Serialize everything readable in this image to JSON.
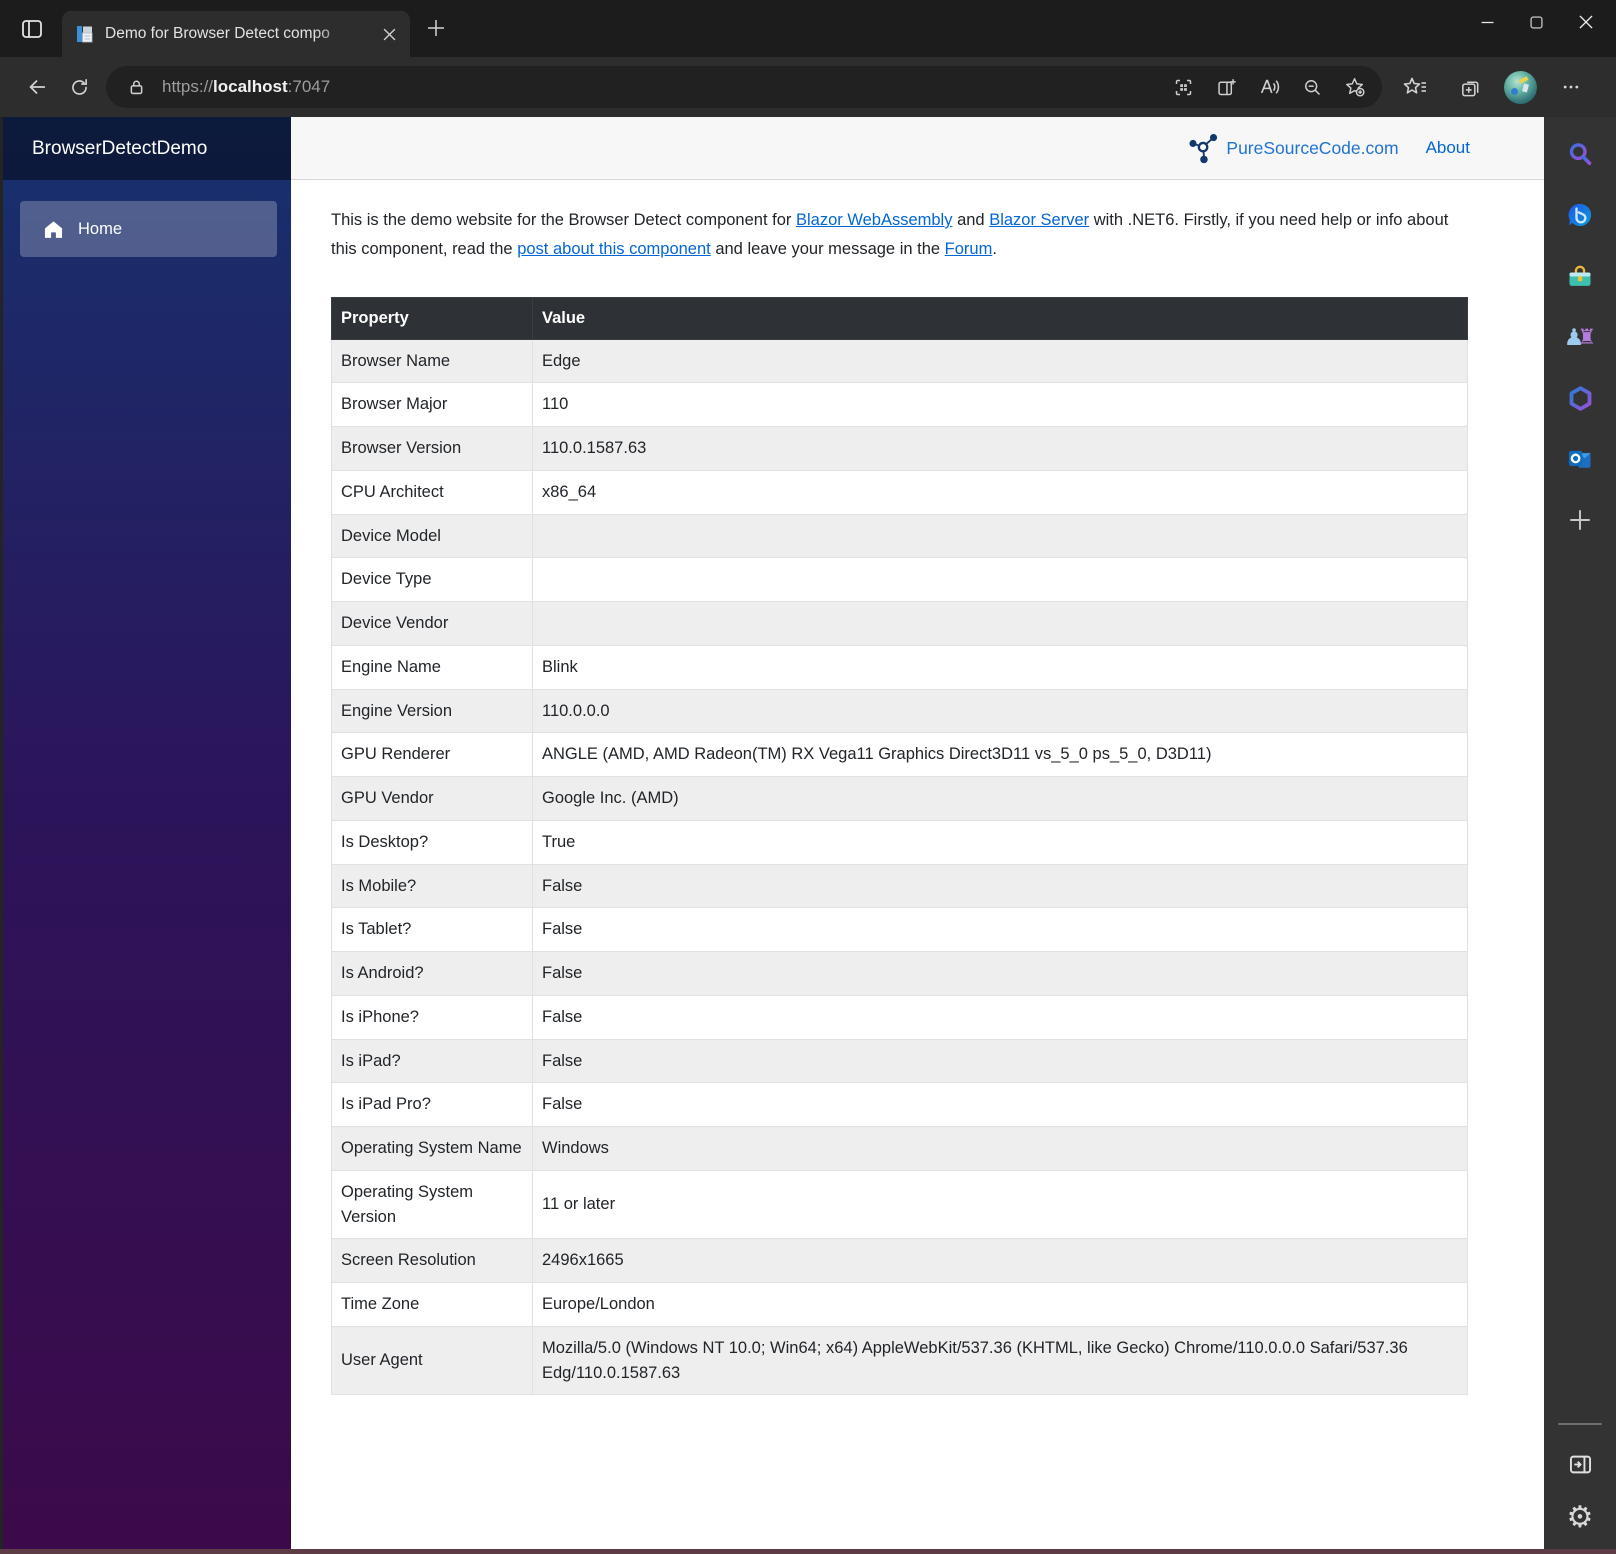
{
  "chrome": {
    "tab_title": "Demo for Browser Detect compo",
    "url": {
      "scheme": "https://",
      "host": "localhost",
      "port": ":7047"
    },
    "tabbar_icons": [
      "tab-actions",
      "page-favicon",
      "tab-close",
      "new-tab",
      "minimize",
      "maximize",
      "close"
    ],
    "toolbar_icons": [
      "back",
      "refresh",
      "site-lock",
      "visual-search",
      "split-screen",
      "read-aloud",
      "zoom-out",
      "add-favorite",
      "favorites",
      "collections",
      "profile-avatar",
      "more-options"
    ]
  },
  "edge_sidebar": {
    "icons": [
      "search",
      "bing-chat",
      "tools",
      "games",
      "microsoft-365",
      "outlook",
      "add-app",
      "open-in-sidebar",
      "settings"
    ]
  },
  "app": {
    "sidebar": {
      "title": "BrowserDetectDemo",
      "items": [
        {
          "label": "Home",
          "icon": "home",
          "active": true
        }
      ]
    },
    "header": {
      "brand": "PureSourceCode.com",
      "about_label": "About"
    },
    "intro_segments": [
      {
        "text": "This is the demo website for the Browser Detect component for ",
        "link": false
      },
      {
        "text": "Blazor WebAssembly",
        "link": true
      },
      {
        "text": " and ",
        "link": false
      },
      {
        "text": "Blazor Server",
        "link": true
      },
      {
        "text": " with .NET6. Firstly, if you need help or info about this component, read the ",
        "link": false
      },
      {
        "text": "post about this component",
        "link": true
      },
      {
        "text": " and leave your message in the ",
        "link": false
      },
      {
        "text": "Forum",
        "link": true
      },
      {
        "text": ".",
        "link": false
      }
    ],
    "table": {
      "columns": [
        "Property",
        "Value"
      ],
      "rows": [
        [
          "Browser Name",
          "Edge"
        ],
        [
          "Browser Major",
          "110"
        ],
        [
          "Browser Version",
          "110.0.1587.63"
        ],
        [
          "CPU Architect",
          "x86_64"
        ],
        [
          "Device Model",
          ""
        ],
        [
          "Device Type",
          ""
        ],
        [
          "Device Vendor",
          ""
        ],
        [
          "Engine Name",
          "Blink"
        ],
        [
          "Engine Version",
          "110.0.0.0"
        ],
        [
          "GPU Renderer",
          "ANGLE (AMD, AMD Radeon(TM) RX Vega11 Graphics Direct3D11 vs_5_0 ps_5_0, D3D11)"
        ],
        [
          "GPU Vendor",
          "Google Inc. (AMD)"
        ],
        [
          "Is Desktop?",
          "True"
        ],
        [
          "Is Mobile?",
          "False"
        ],
        [
          "Is Tablet?",
          "False"
        ],
        [
          "Is Android?",
          "False"
        ],
        [
          "Is iPhone?",
          "False"
        ],
        [
          "Is iPad?",
          "False"
        ],
        [
          "Is iPad Pro?",
          "False"
        ],
        [
          "Operating System Name",
          "Windows"
        ],
        [
          "Operating System Version",
          "11 or later"
        ],
        [
          "Screen Resolution",
          "2496x1665"
        ],
        [
          "Time Zone",
          "Europe/London"
        ],
        [
          "User Agent",
          "Mozilla/5.0 (Windows NT 10.0; Win64; x64) AppleWebKit/537.36 (KHTML, like Gecko) Chrome/110.0.0.0 Safari/537.36 Edg/110.0.1587.63"
        ]
      ]
    }
  },
  "colors": {
    "sidebar_gradient_top": "#17316e",
    "sidebar_gradient_bottom": "#3c0a4a",
    "link_blue": "#0366d6",
    "table_header_bg": "#2e3236",
    "stripe_gray": "#eeeeee",
    "chrome_dark": "#2d2d2d",
    "bottom_accent": "#5e3c45"
  }
}
